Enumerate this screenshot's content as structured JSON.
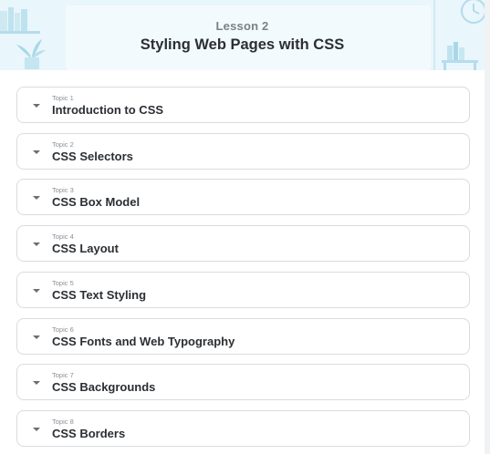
{
  "header": {
    "lesson_label": "Lesson 2",
    "lesson_title": "Styling Web Pages with CSS"
  },
  "topics": [
    {
      "number": "Topic 1",
      "title": "Introduction to CSS"
    },
    {
      "number": "Topic 2",
      "title": "CSS Selectors"
    },
    {
      "number": "Topic 3",
      "title": "CSS Box Model"
    },
    {
      "number": "Topic 4",
      "title": "CSS Layout"
    },
    {
      "number": "Topic 5",
      "title": "CSS Text Styling"
    },
    {
      "number": "Topic 6",
      "title": "CSS Fonts and Web Typography"
    },
    {
      "number": "Topic 7",
      "title": "CSS Backgrounds"
    },
    {
      "number": "Topic 8",
      "title": "CSS Borders"
    }
  ],
  "icons": {
    "topic_toggle": "caret-down-icon"
  },
  "colors": {
    "banner_background": "#e9f6fb",
    "title_text": "#2b2f33",
    "label_text": "#7d8186",
    "card_border": "#d9dcdf"
  }
}
